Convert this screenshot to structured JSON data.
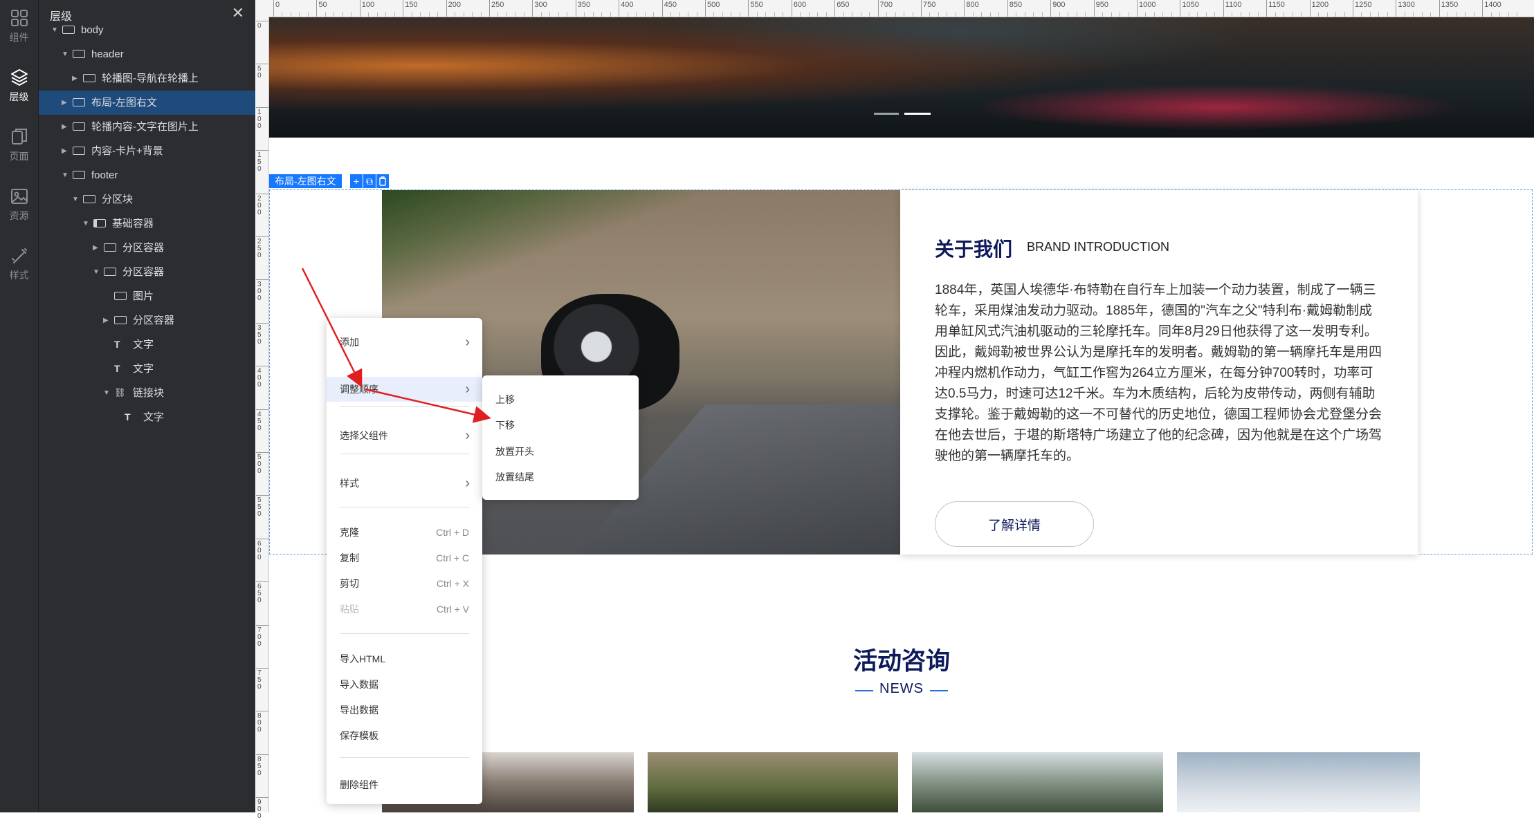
{
  "rail": {
    "items": [
      {
        "label": "组件",
        "icon": "grid-icon"
      },
      {
        "label": "层级",
        "icon": "layers-icon"
      },
      {
        "label": "页面",
        "icon": "pages-icon"
      },
      {
        "label": "资源",
        "icon": "image-icon"
      },
      {
        "label": "样式",
        "icon": "brush-icon"
      }
    ]
  },
  "panel": {
    "title": "层级",
    "tree": [
      {
        "label": "body",
        "caret": "▼",
        "icon": "layout-icon"
      },
      {
        "label": "header",
        "caret": "▼",
        "icon": "box-icon"
      },
      {
        "label": "轮播图-导航在轮播上",
        "caret": "▶",
        "icon": "section-icon"
      },
      {
        "label": "布局-左图右文",
        "caret": "▶",
        "icon": "section-icon"
      },
      {
        "label": "轮播内容-文字在图片上",
        "caret": "▶",
        "icon": "section-icon"
      },
      {
        "label": "内容-卡片+背景",
        "caret": "▶",
        "icon": "section-icon"
      },
      {
        "label": "footer",
        "caret": "▼",
        "icon": "box-icon"
      },
      {
        "label": "分区块",
        "caret": "▼",
        "icon": "section-icon"
      },
      {
        "label": "基础容器",
        "caret": "▼",
        "icon": "columns-icon"
      },
      {
        "label": "分区容器",
        "caret": "▶",
        "icon": "section-icon"
      },
      {
        "label": "分区容器",
        "caret": "▼",
        "icon": "section-icon"
      },
      {
        "label": "图片",
        "caret": "",
        "icon": "image-icon"
      },
      {
        "label": "分区容器",
        "caret": "▶",
        "icon": "section-icon"
      },
      {
        "label": "文字",
        "caret": "",
        "icon": "text-icon"
      },
      {
        "label": "文字",
        "caret": "",
        "icon": "text-icon"
      },
      {
        "label": "链接块",
        "caret": "▼",
        "icon": "link-icon"
      },
      {
        "label": "文字",
        "caret": "",
        "icon": "text-icon"
      }
    ],
    "selected_index": 3
  },
  "ruler": {
    "ticks": [
      "0",
      "50",
      "100",
      "150",
      "200",
      "250",
      "300",
      "350",
      "400",
      "450",
      "500",
      "550",
      "600",
      "650",
      "700",
      "750",
      "800",
      "850",
      "900",
      "950",
      "1000",
      "1050",
      "1100",
      "1150",
      "1200",
      "1250",
      "1300",
      "1350",
      "1400"
    ],
    "left_ticks": [
      "0",
      "50",
      "100",
      "150",
      "200",
      "250",
      "300",
      "350",
      "400",
      "450",
      "500",
      "550",
      "600",
      "650",
      "700",
      "750",
      "800",
      "850",
      "900"
    ]
  },
  "selection": {
    "tag": "布局-左图右文",
    "buttons": [
      "+",
      "⧉",
      "🗑"
    ]
  },
  "about": {
    "title": "关于我们",
    "subtitle": "BRAND INTRODUCTION",
    "text": "1884年，英国人埃德华·布特勒在自行车上加装一个动力装置，制成了一辆三轮车，采用煤油发动力驱动。1885年，德国的\"汽车之父\"特利布·戴姆勒制成用单缸风式汽油机驱动的三轮摩托车。同年8月29日他获得了这一发明专利。因此，戴姆勒被世界公认为是摩托车的发明者。戴姆勒的第一辆摩托车是用四冲程内燃机作动力，气缸工作窖为264立方厘米，在每分钟700转时，功率可达0.5马力，时速可达12千米。车为木质结构，后轮为皮带传动，两侧有辅助支撑轮。鉴于戴姆勒的这一不可替代的历史地位，德国工程师协会尤登堡分会在他去世后，于堪的斯塔特广场建立了他的纪念碑，因为他就是在这个广场驾驶他的第一辆摩托车的。",
    "button": "了解详情"
  },
  "news": {
    "title": "活动咨询",
    "subtitle": "NEWS"
  },
  "context_menu": {
    "items": [
      {
        "label": "添加",
        "shortcut": "",
        "submenu": true
      },
      {
        "label": "调整顺序",
        "shortcut": "",
        "submenu": true
      },
      {
        "label": "选择父组件",
        "shortcut": "",
        "submenu": true
      },
      {
        "label": "样式",
        "shortcut": "",
        "submenu": true
      },
      {
        "label": "克隆",
        "shortcut": "Ctrl + D"
      },
      {
        "label": "复制",
        "shortcut": "Ctrl + C"
      },
      {
        "label": "剪切",
        "shortcut": "Ctrl + X"
      },
      {
        "label": "粘贴",
        "shortcut": "Ctrl + V"
      },
      {
        "label": "导入HTML",
        "shortcut": ""
      },
      {
        "label": "导入数据",
        "shortcut": ""
      },
      {
        "label": "导出数据",
        "shortcut": ""
      },
      {
        "label": "保存模板",
        "shortcut": ""
      },
      {
        "label": "删除组件",
        "shortcut": ""
      }
    ],
    "submenu_items": [
      "上移",
      "下移",
      "放置开头",
      "放置结尾"
    ]
  },
  "colors": {
    "accent": "#1677ff",
    "navy": "#0e1a5c",
    "selected_row": "#1f4b7c",
    "annotation_arrow": "#e02020"
  }
}
